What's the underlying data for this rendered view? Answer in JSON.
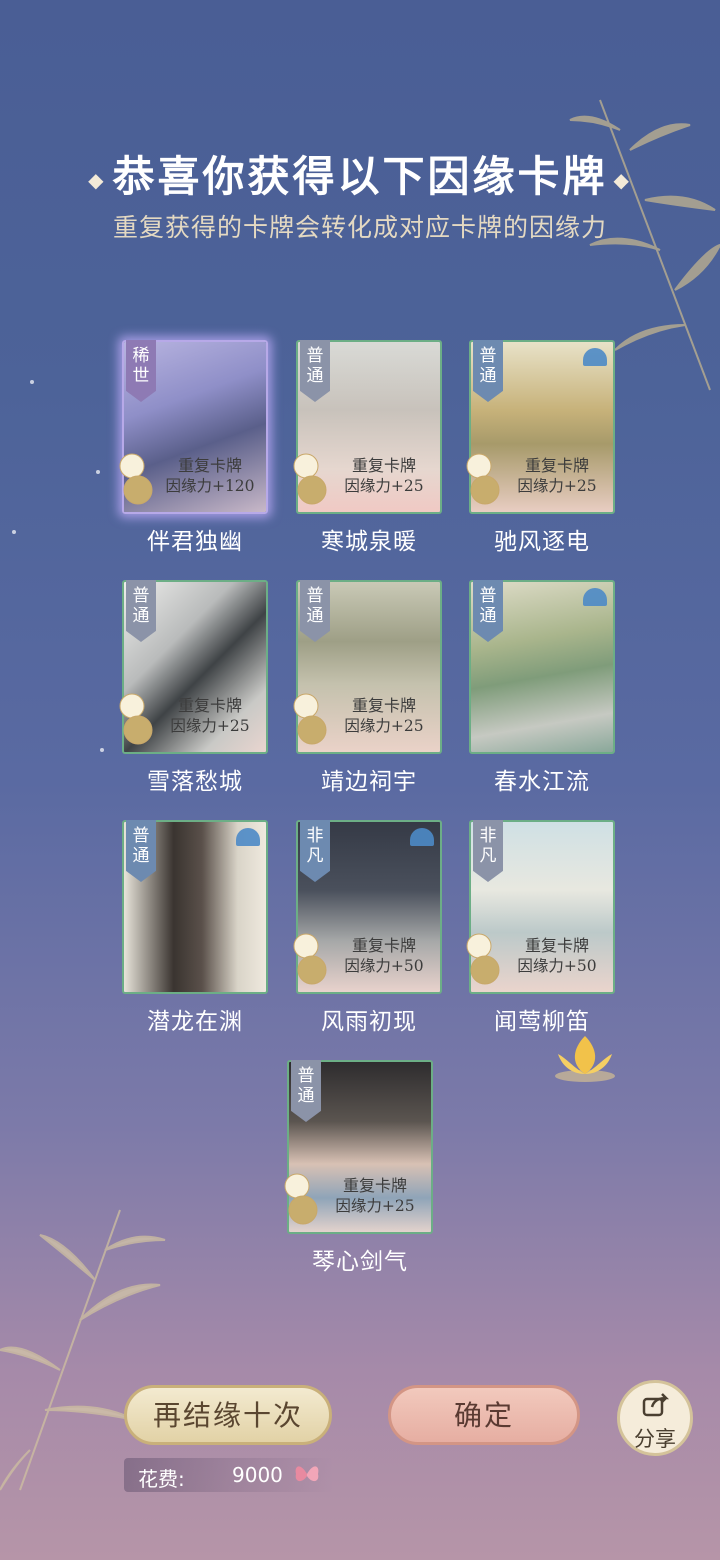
{
  "header": {
    "title": "恭喜你获得以下因缘卡牌",
    "subtitle": "重复获得的卡牌会转化成对应卡牌的因缘力"
  },
  "cards": [
    {
      "name": "伴君独幽",
      "rarity": "稀世",
      "duplicate": true,
      "dup_line1": "重复卡牌",
      "dup_line2": "因缘力+120"
    },
    {
      "name": "寒城泉暖",
      "rarity": "普通",
      "duplicate": true,
      "dup_line1": "重复卡牌",
      "dup_line2": "因缘力+25"
    },
    {
      "name": "驰风逐电",
      "rarity": "普通",
      "duplicate": true,
      "dup_line1": "重复卡牌",
      "dup_line2": "因缘力+25"
    },
    {
      "name": "雪落愁城",
      "rarity": "普通",
      "duplicate": true,
      "dup_line1": "重复卡牌",
      "dup_line2": "因缘力+25"
    },
    {
      "name": "靖边祠宇",
      "rarity": "普通",
      "duplicate": true,
      "dup_line1": "重复卡牌",
      "dup_line2": "因缘力+25"
    },
    {
      "name": "春水江流",
      "rarity": "普通",
      "duplicate": false
    },
    {
      "name": "潜龙在渊",
      "rarity": "普通",
      "duplicate": false
    },
    {
      "name": "风雨初现",
      "rarity": "非凡",
      "duplicate": true,
      "dup_line1": "重复卡牌",
      "dup_line2": "因缘力+50"
    },
    {
      "name": "闻莺柳笛",
      "rarity": "非凡",
      "duplicate": true,
      "dup_line1": "重复卡牌",
      "dup_line2": "因缘力+50"
    },
    {
      "name": "琴心剑气",
      "rarity": "普通",
      "duplicate": true,
      "dup_line1": "重复卡牌",
      "dup_line2": "因缘力+25"
    }
  ],
  "buttons": {
    "again_label": "再结缘十次",
    "confirm_label": "确定",
    "share_label": "分享"
  },
  "cost": {
    "label": "花费:",
    "value": "9000",
    "currency_icon": "butterfly-icon"
  },
  "colors": {
    "card_border_normal": "#6cae86",
    "card_border_rare": "#b7a9e8",
    "btn_again": "#e8dbb4",
    "btn_confirm": "#eab8ab"
  }
}
